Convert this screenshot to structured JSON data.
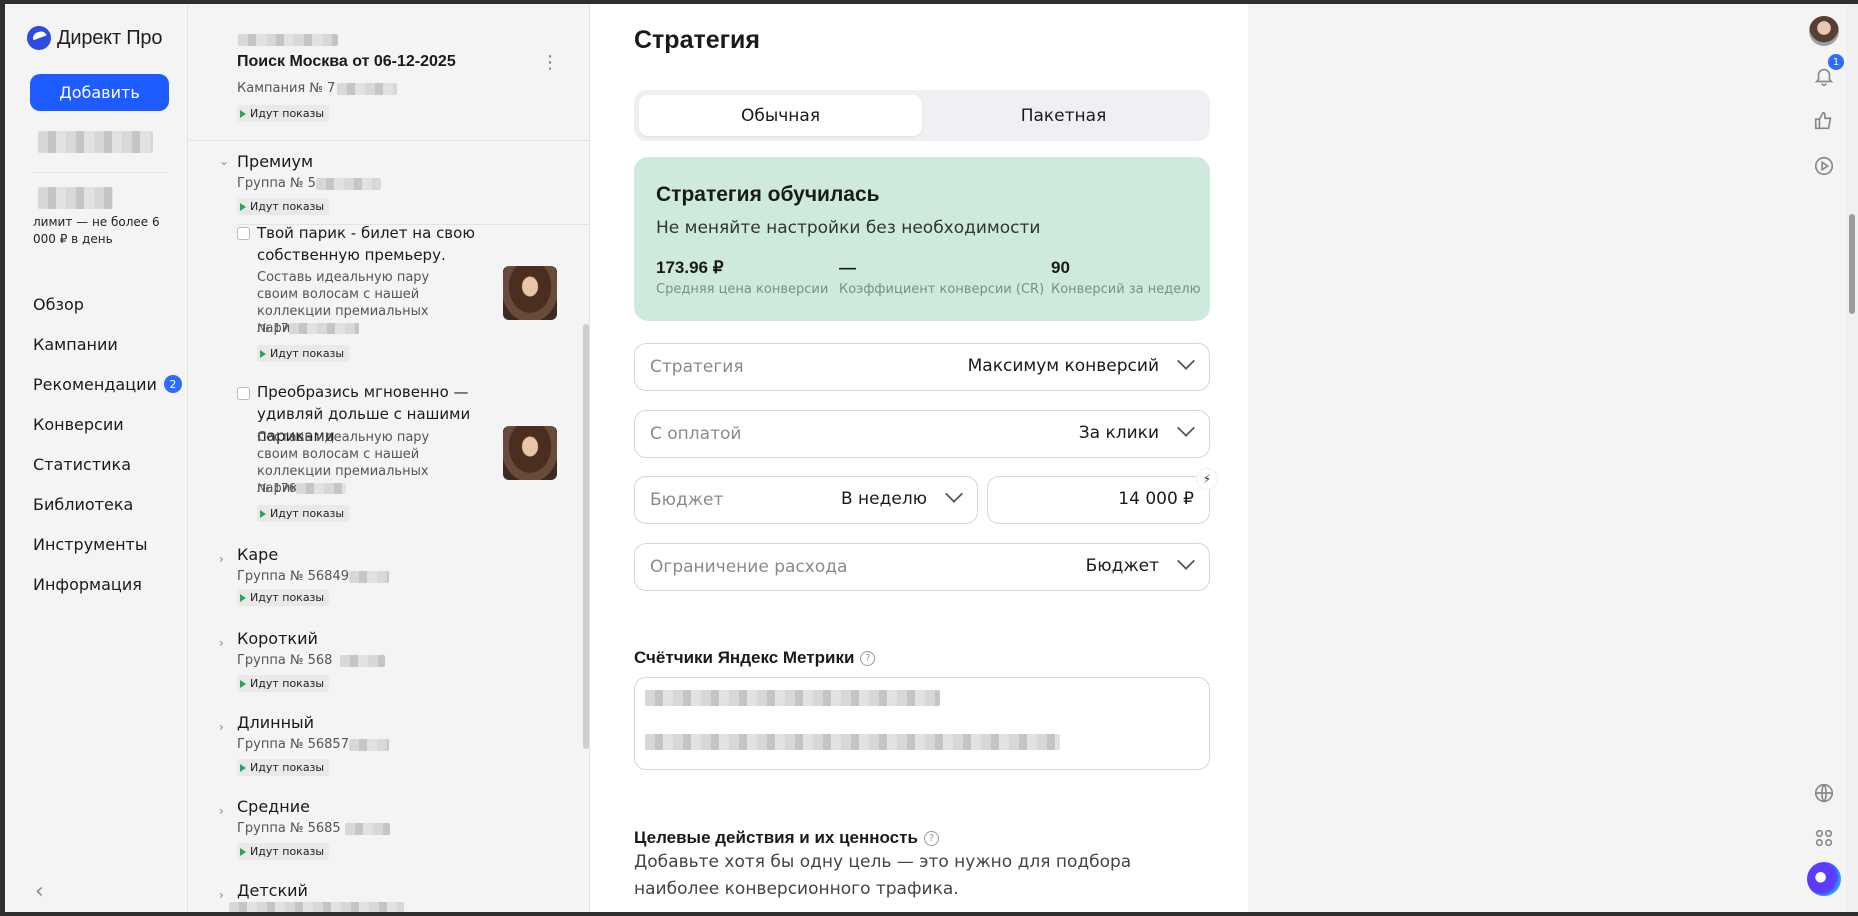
{
  "nav": {
    "logo": "Директ Про",
    "add_button": "Добавить",
    "limit_text": "лимит — не более 6 000 ₽ в день",
    "items": [
      {
        "label": "Обзор"
      },
      {
        "label": "Кампании"
      },
      {
        "label": "Рекомендации",
        "badge": "2"
      },
      {
        "label": "Конверсии"
      },
      {
        "label": "Статистика"
      },
      {
        "label": "Библиотека"
      },
      {
        "label": "Инструменты"
      },
      {
        "label": "Информация"
      }
    ],
    "collapse_icon": "chevron-left-icon"
  },
  "list": {
    "campaign_title": "Поиск Москва от 06-12-2025",
    "campaign_number": "Кампания № 7",
    "status_label": "Идут показы",
    "group_premium": {
      "title": "Премиум",
      "number": "Группа № 5"
    },
    "ads": [
      {
        "title": "Твой парик - билет на свою собственную премьеру.",
        "body": "Составь идеальную пару своим волосам с нашей коллекции премиальных париков.",
        "number": "№ 17"
      },
      {
        "title": "Преобразись мгновенно — удивляй дольше с нашими париками",
        "body": "Составь идеальную пару своим волосам с нашей коллекции премиальных париков.",
        "number": "№ 176"
      }
    ],
    "groups": [
      {
        "title": "Каре",
        "number": "Группа № 56849"
      },
      {
        "title": "Короткий",
        "number": "Группа № 568"
      },
      {
        "title": "Длинный",
        "number": "Группа № 56857"
      },
      {
        "title": "Средние",
        "number": "Группа № 5685"
      },
      {
        "title": "Детский",
        "number": ""
      }
    ]
  },
  "main": {
    "title": "Стратегия",
    "tabs": [
      "Обычная",
      "Пакетная"
    ],
    "learned": {
      "title": "Стратегия обучилась",
      "subtitle": "Не меняйте настройки без необходимости",
      "stats": [
        {
          "value": "173.96 ₽",
          "label": "Средняя цена конверсии"
        },
        {
          "value": "—",
          "label": "Коэффициент конверсии (CR)"
        },
        {
          "value": "90",
          "label": "Конверсий за неделю"
        }
      ]
    },
    "fields": {
      "strategy": {
        "label": "Стратегия",
        "value": "Максимум конверсий"
      },
      "payment": {
        "label": "С оплатой",
        "value": "За клики"
      },
      "budget": {
        "label": "Бюджет",
        "value": "В неделю"
      },
      "budget_amount": "14 000  ₽",
      "limit": {
        "label": "Ограничение расхода",
        "value": "Бюджет"
      }
    },
    "metrika_title": "Счётчики Яндекс Метрики",
    "goals_title": "Целевые действия и их ценность",
    "goals_text": "Добавьте хотя бы одну цель — это нужно для подбора наиболее конверсионного трафика."
  },
  "rail": {
    "notifications_badge": "1"
  },
  "colors": {
    "accent": "#1f5cff",
    "learned_bg": "#cdeadd",
    "status_green": "#26a65b"
  }
}
